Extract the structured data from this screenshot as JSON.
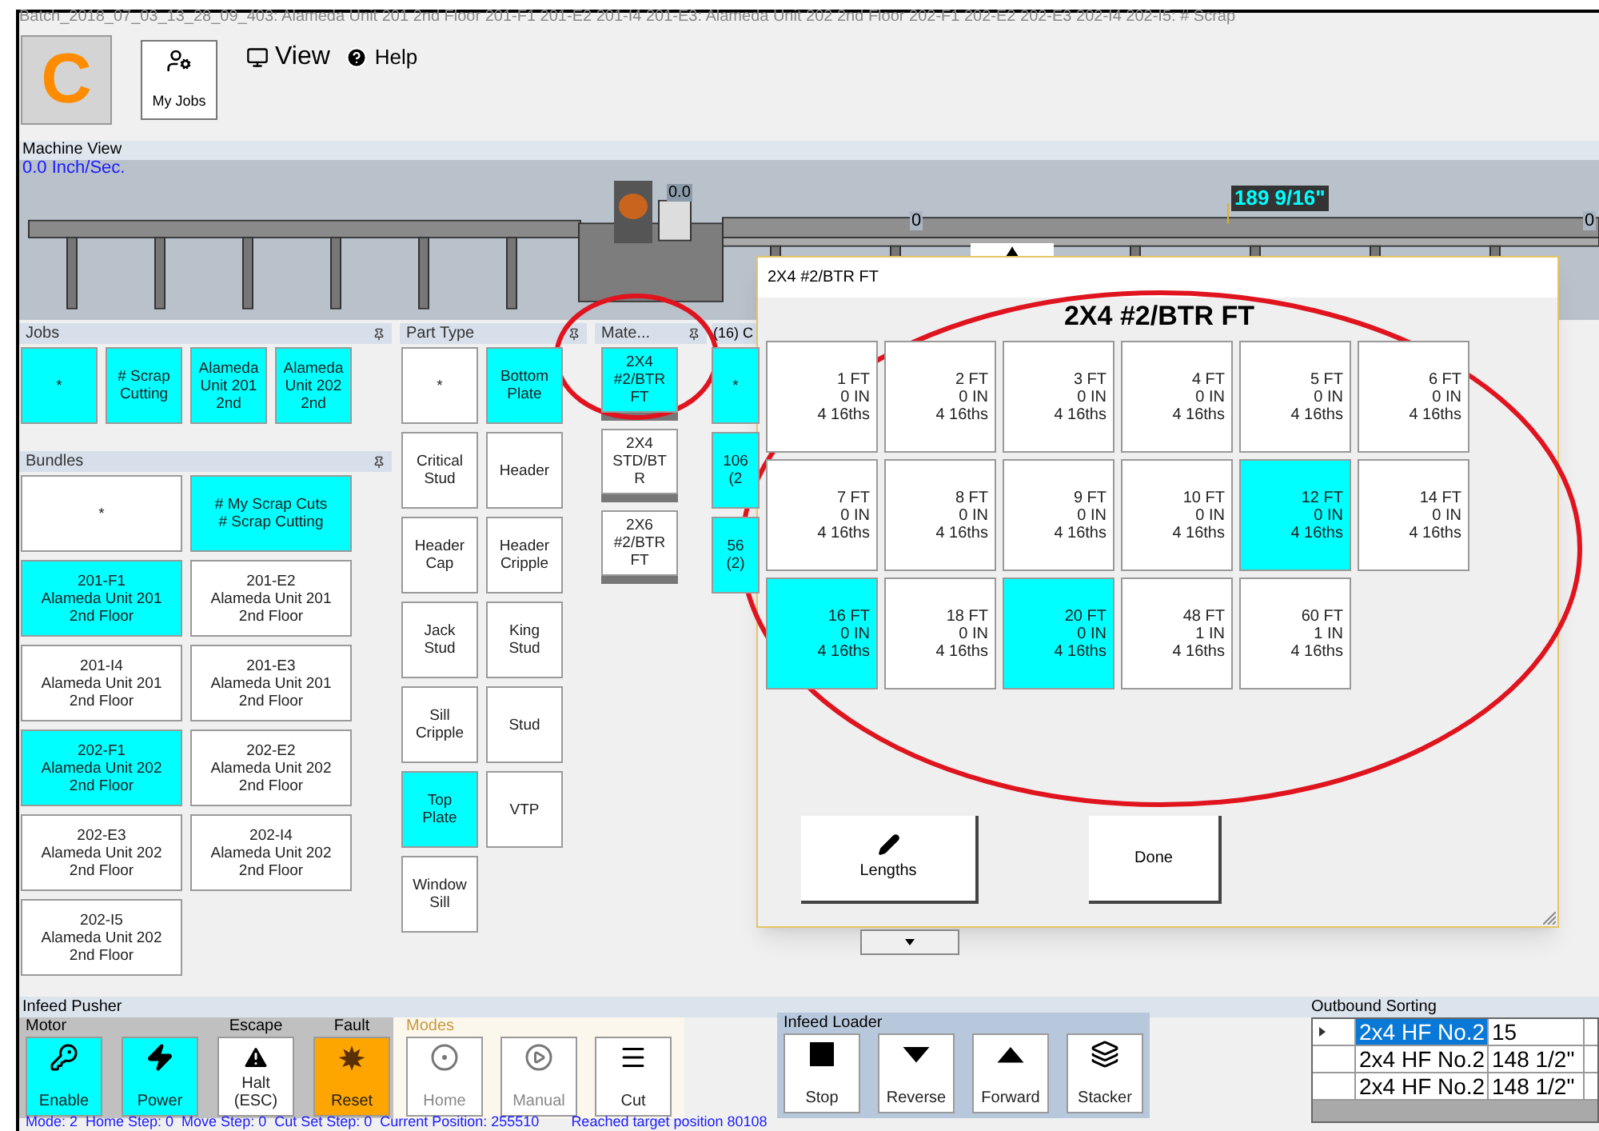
{
  "title_bar": "Batch_2018_07_03_13_28_09_403: Alameda Unit 201 2nd Floor  201-F1 201-E2 201-I4 201-E3: Alameda Unit 202 2nd Floor  202-F1 202-E2 202-E3 202-I4 202-I5: # Scrap",
  "toolbar": {
    "logo": "C",
    "my_jobs": "My Jobs",
    "menus": [
      {
        "label": "View",
        "kind": "view"
      },
      {
        "label": "Help",
        "kind": "help"
      }
    ]
  },
  "machine_view": {
    "title": "Machine View",
    "speed": "0.0 Inch/Sec.",
    "saw_reading": "0.0",
    "length_reading": "189 9/16\"",
    "markers": [
      "0",
      "0"
    ]
  },
  "jobs": {
    "title": "Jobs",
    "items": [
      {
        "lines": [
          "*"
        ],
        "selected": true
      },
      {
        "lines": [
          "# Scrap",
          "Cutting"
        ],
        "selected": true
      },
      {
        "lines": [
          "Alameda",
          "Unit 201",
          "2nd"
        ],
        "selected": true
      },
      {
        "lines": [
          "Alameda",
          "Unit 202",
          "2nd"
        ],
        "selected": true
      }
    ]
  },
  "bundles": {
    "title": "Bundles",
    "items": [
      {
        "lines": [
          "*"
        ],
        "selected": false
      },
      {
        "lines": [
          "201-F1",
          "Alameda Unit 201",
          "2nd Floor"
        ],
        "selected": true
      },
      {
        "lines": [
          "201-I4",
          "Alameda Unit 201",
          "2nd Floor"
        ],
        "selected": false
      },
      {
        "lines": [
          "202-F1",
          "Alameda Unit 202",
          "2nd Floor"
        ],
        "selected": true
      },
      {
        "lines": [
          "202-E3",
          "Alameda Unit 202",
          "2nd Floor"
        ],
        "selected": false
      },
      {
        "lines": [
          "202-I5",
          "Alameda Unit 202",
          "2nd Floor"
        ],
        "selected": false
      },
      {
        "lines": [
          "# My Scrap Cuts",
          "# Scrap Cutting"
        ],
        "selected": true
      },
      {
        "lines": [
          "201-E2",
          "Alameda Unit 201",
          "2nd Floor"
        ],
        "selected": false
      },
      {
        "lines": [
          "201-E3",
          "Alameda Unit 201",
          "2nd Floor"
        ],
        "selected": false
      },
      {
        "lines": [
          "202-E2",
          "Alameda Unit 202",
          "2nd Floor"
        ],
        "selected": false
      },
      {
        "lines": [
          "202-I4",
          "Alameda Unit 202",
          "2nd Floor"
        ],
        "selected": false
      }
    ]
  },
  "part_type": {
    "title": "Part Type",
    "items": [
      {
        "lines": [
          "*"
        ],
        "selected": false
      },
      {
        "lines": [
          "Critical",
          "Stud"
        ],
        "selected": false
      },
      {
        "lines": [
          "Header",
          "Cap"
        ],
        "selected": false
      },
      {
        "lines": [
          "Jack",
          "Stud"
        ],
        "selected": false
      },
      {
        "lines": [
          "Sill",
          "Cripple"
        ],
        "selected": false
      },
      {
        "lines": [
          "Top",
          "Plate"
        ],
        "selected": true
      },
      {
        "lines": [
          "Window",
          "Sill"
        ],
        "selected": false
      },
      {
        "lines": [
          "Bottom",
          "Plate"
        ],
        "selected": true
      },
      {
        "lines": [
          "Header"
        ],
        "selected": false
      },
      {
        "lines": [
          "Header",
          "Cripple"
        ],
        "selected": false
      },
      {
        "lines": [
          "King",
          "Stud"
        ],
        "selected": false
      },
      {
        "lines": [
          "Stud"
        ],
        "selected": false
      },
      {
        "lines": [
          "VTP"
        ],
        "selected": false
      }
    ]
  },
  "material": {
    "title": "Mate...",
    "items": [
      {
        "lines": [
          "2X4",
          "#2/BTR",
          "FT"
        ],
        "selected": true
      },
      {
        "lines": [
          "2X4",
          "STD/BT",
          "R"
        ],
        "selected": false
      },
      {
        "lines": [
          "2X6",
          "#2/BTR",
          "FT"
        ],
        "selected": false
      }
    ]
  },
  "cuts": {
    "title": "(16) C",
    "items": [
      {
        "lines": [
          "*"
        ],
        "selected": true
      },
      {
        "lines": [
          "106",
          "(2"
        ],
        "selected": true
      },
      {
        "lines": [
          "56",
          "(2)"
        ],
        "selected": true
      }
    ]
  },
  "dialog": {
    "title": "2X4 #2/BTR FT",
    "heading": "2X4 #2/BTR FT",
    "lengths": [
      {
        "feet": "1 FT",
        "inches": "0 IN",
        "sixteenths": "4 16ths",
        "selected": false
      },
      {
        "feet": "2 FT",
        "inches": "0 IN",
        "sixteenths": "4 16ths",
        "selected": false
      },
      {
        "feet": "3 FT",
        "inches": "0 IN",
        "sixteenths": "4 16ths",
        "selected": false
      },
      {
        "feet": "4 FT",
        "inches": "0 IN",
        "sixteenths": "4 16ths",
        "selected": false
      },
      {
        "feet": "5 FT",
        "inches": "0 IN",
        "sixteenths": "4 16ths",
        "selected": false
      },
      {
        "feet": "6 FT",
        "inches": "0 IN",
        "sixteenths": "4 16ths",
        "selected": false
      },
      {
        "feet": "7 FT",
        "inches": "0 IN",
        "sixteenths": "4 16ths",
        "selected": false
      },
      {
        "feet": "8 FT",
        "inches": "0 IN",
        "sixteenths": "4 16ths",
        "selected": false
      },
      {
        "feet": "9 FT",
        "inches": "0 IN",
        "sixteenths": "4 16ths",
        "selected": false
      },
      {
        "feet": "10 FT",
        "inches": "0 IN",
        "sixteenths": "4 16ths",
        "selected": false
      },
      {
        "feet": "12 FT",
        "inches": "0 IN",
        "sixteenths": "4 16ths",
        "selected": true
      },
      {
        "feet": "14 FT",
        "inches": "0 IN",
        "sixteenths": "4 16ths",
        "selected": false
      },
      {
        "feet": "16 FT",
        "inches": "0 IN",
        "sixteenths": "4 16ths",
        "selected": true
      },
      {
        "feet": "18 FT",
        "inches": "0 IN",
        "sixteenths": "4 16ths",
        "selected": false
      },
      {
        "feet": "20 FT",
        "inches": "0 IN",
        "sixteenths": "4 16ths",
        "selected": true
      },
      {
        "feet": "48 FT",
        "inches": "1 IN",
        "sixteenths": "4 16ths",
        "selected": false
      },
      {
        "feet": "60 FT",
        "inches": "1 IN",
        "sixteenths": "4 16ths",
        "selected": false
      }
    ],
    "buttons": [
      {
        "label": "Lengths",
        "kind": "edit"
      },
      {
        "label": "Done",
        "kind": "plain"
      }
    ]
  },
  "infeed_pusher": {
    "title": "Infeed Pusher",
    "groups": [
      {
        "label": "Motor",
        "buttons": [
          {
            "label": "Enable",
            "kind": "key",
            "active": true,
            "fault": false
          },
          {
            "label": "Power",
            "kind": "bolt",
            "active": true,
            "fault": false
          }
        ]
      },
      {
        "label": "Escape",
        "buttons": [
          {
            "label": "Halt\n(ESC)",
            "kind": "warning",
            "active": false,
            "fault": false
          }
        ]
      },
      {
        "label": "Fault",
        "buttons": [
          {
            "label": "Reset",
            "kind": "burst",
            "fault": true
          }
        ]
      }
    ]
  },
  "modes": {
    "title": "Modes",
    "buttons": [
      {
        "label": "Home",
        "kind": "target",
        "disabled": true
      },
      {
        "label": "Manual",
        "kind": "play",
        "disabled": true
      },
      {
        "label": "Cut",
        "kind": "lines",
        "disabled": false
      }
    ]
  },
  "infeed_loader": {
    "title": "Infeed Loader",
    "buttons": [
      {
        "label": "Stop",
        "kind": "square"
      },
      {
        "label": "Reverse",
        "kind": "down"
      },
      {
        "label": "Forward",
        "kind": "up"
      },
      {
        "label": "Stacker",
        "kind": "stack"
      }
    ]
  },
  "outbound_sorting": {
    "title": "Outbound Sorting",
    "rows": [
      {
        "cells": [
          "2x4 HF No.2",
          "15"
        ],
        "selected": true
      },
      {
        "cells": [
          "2x4 HF No.2",
          "148 1/2\""
        ],
        "selected": false
      },
      {
        "cells": [
          "2x4 HF No.2",
          "148 1/2\""
        ],
        "selected": false
      }
    ]
  },
  "status_bar": [
    "Mode: 2  Home Step: 0  Move Step: 0  Cut Set Step: 0  Current Position: 255510",
    "Reached target position 80108"
  ]
}
